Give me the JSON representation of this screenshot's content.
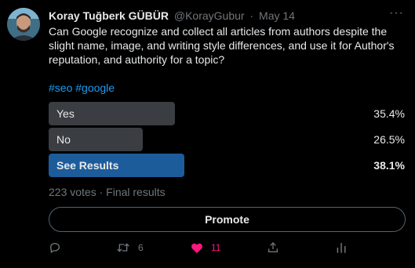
{
  "tweet": {
    "author_name": "Koray Tuğberk GÜBÜR",
    "handle": "@KorayGubur",
    "separator": "·",
    "date": "May 14",
    "more_label": "···",
    "text": "Can Google recognize and collect all articles from authors despite the slight name, image, and writing style differences, and use it for Author's reputation, and authority for a topic?",
    "hashtags": [
      "#seo",
      "#google"
    ]
  },
  "poll": {
    "options": [
      {
        "label": "Yes",
        "percent": "35.4%",
        "fraction": 0.354,
        "winner": false
      },
      {
        "label": "No",
        "percent": "26.5%",
        "fraction": 0.265,
        "winner": false
      },
      {
        "label": "See Results",
        "percent": "38.1%",
        "fraction": 0.381,
        "winner": true
      }
    ],
    "votes_text": "223 votes · Final results"
  },
  "promote_label": "Promote",
  "actions": {
    "reply_count": "",
    "retweet_count": "6",
    "like_count": "11",
    "like_color": "#f91880"
  },
  "colors": {
    "background": "#000000",
    "text": "#e7e9ea",
    "muted": "#71767b",
    "accent": "#1d9bf0",
    "bar": "#3a3d41",
    "bar_winner": "#1d5c9b"
  }
}
